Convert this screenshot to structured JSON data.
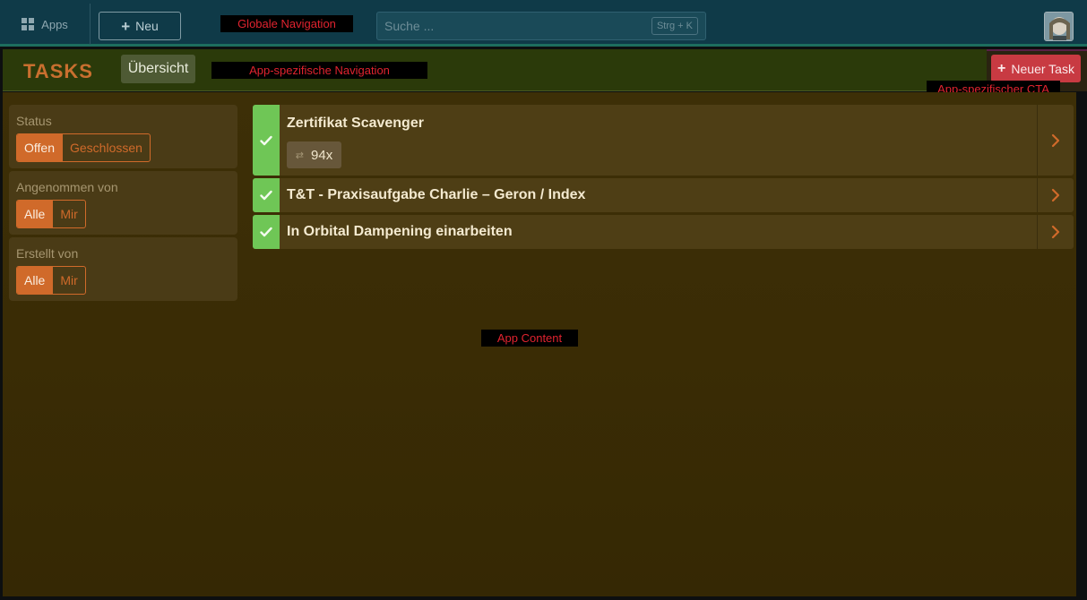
{
  "global_nav": {
    "apps_label": "Apps",
    "new_label": "Neu",
    "search_placeholder": "Suche ...",
    "search_shortcut": "Strg + K",
    "annotation": "Globale Navigation"
  },
  "app_nav": {
    "logo": "TASKS",
    "tab_overview": "Übersicht",
    "annotation": "App-spezifische Navigation",
    "cta_label": "Neuer Task",
    "cta_annotation": "App-spezifischer CTA"
  },
  "filters": [
    {
      "label": "Status",
      "options": [
        "Offen",
        "Geschlossen"
      ],
      "active": 0
    },
    {
      "label": "Angenommen von",
      "options": [
        "Alle",
        "Mir"
      ],
      "active": 0
    },
    {
      "label": "Erstellt von",
      "options": [
        "Alle",
        "Mir"
      ],
      "active": 0
    }
  ],
  "tasks": [
    {
      "title": "Zertifikat Scavenger",
      "repeat": "94x"
    },
    {
      "title": "T&T - Praxisaufgabe Charlie – Geron / Index"
    },
    {
      "title": "In Orbital Dampening einarbeiten"
    }
  ],
  "content_annotation": "App Content",
  "colors": {
    "global_nav_bg": "#0f3a48",
    "app_nav_bg": "#2b3a0a",
    "accent_orange": "#d06a2a",
    "cta_red": "#c83a42",
    "check_green": "#6fc656"
  }
}
